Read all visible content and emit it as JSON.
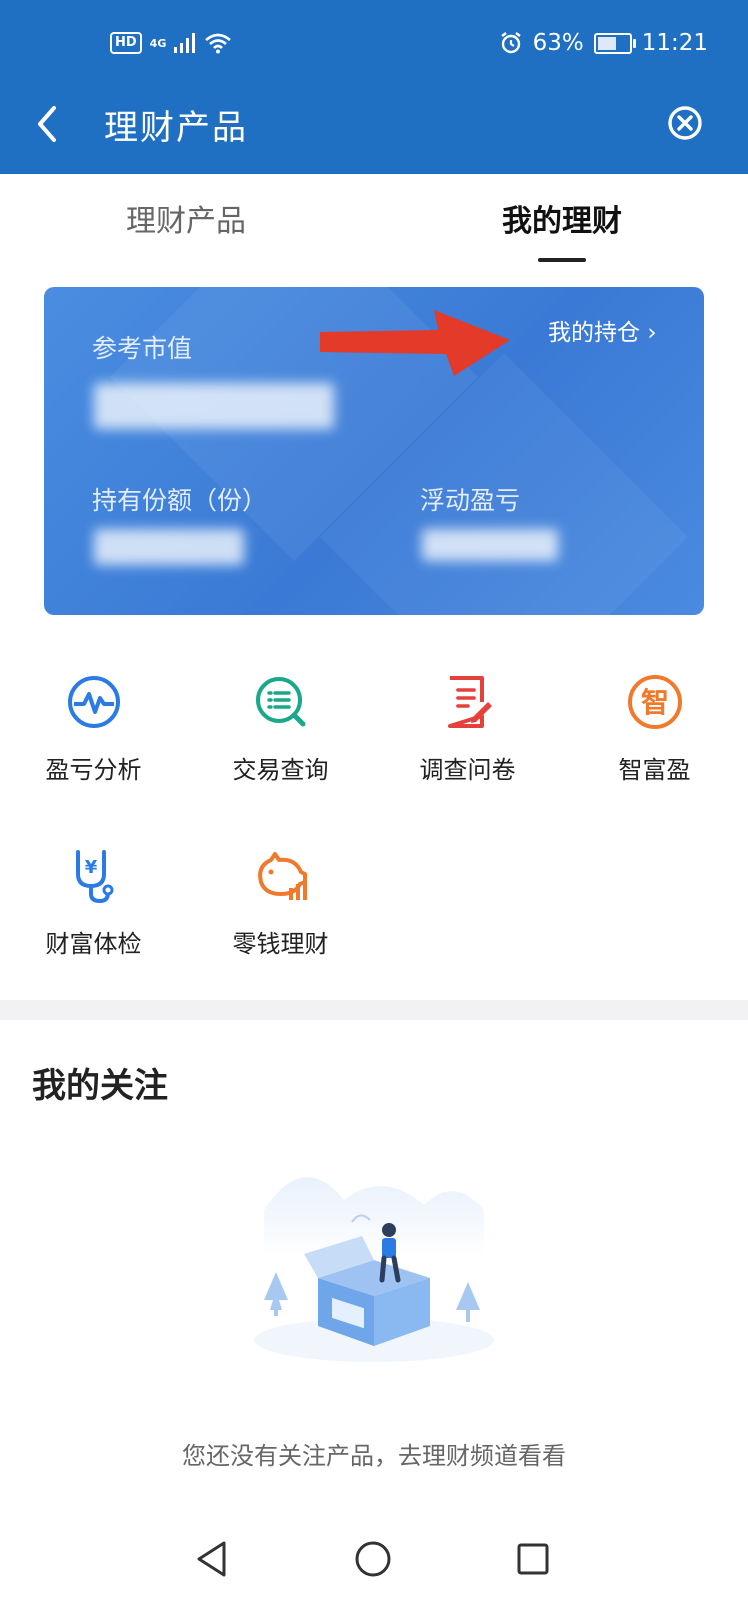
{
  "status_bar": {
    "hd": "HD",
    "network": "4G",
    "battery_percent": "63%",
    "battery_level": 0.63,
    "time": "11:21"
  },
  "header": {
    "title": "理财产品"
  },
  "tabs": [
    {
      "label": "理财产品",
      "active": false
    },
    {
      "label": "我的理财",
      "active": true
    }
  ],
  "card": {
    "market_value_label": "参考市值",
    "holding_link": "我的持仓",
    "shares_label": "持有份额（份）",
    "pnl_label": "浮动盈亏"
  },
  "shortcuts": [
    {
      "label": "盈亏分析",
      "icon": "pulse-icon",
      "color": "#2b7be5"
    },
    {
      "label": "交易查询",
      "icon": "search-list-icon",
      "color": "#19a88a"
    },
    {
      "label": "调查问卷",
      "icon": "survey-icon",
      "color": "#e5403a"
    },
    {
      "label": "智富盈",
      "icon": "zhi-badge-icon",
      "color": "#f07a2c"
    },
    {
      "label": "财富体检",
      "icon": "stethoscope-icon",
      "color": "#2b7be5"
    },
    {
      "label": "零钱理财",
      "icon": "piggy-bank-icon",
      "color": "#f07a2c"
    }
  ],
  "favorites": {
    "title": "我的关注",
    "empty_text": "您还没有关注产品，去理财频道看看"
  },
  "colors": {
    "header_bg": "#1f6fc2",
    "card_bg": "#3a7ad6",
    "annotation_arrow": "#e33a2a"
  }
}
